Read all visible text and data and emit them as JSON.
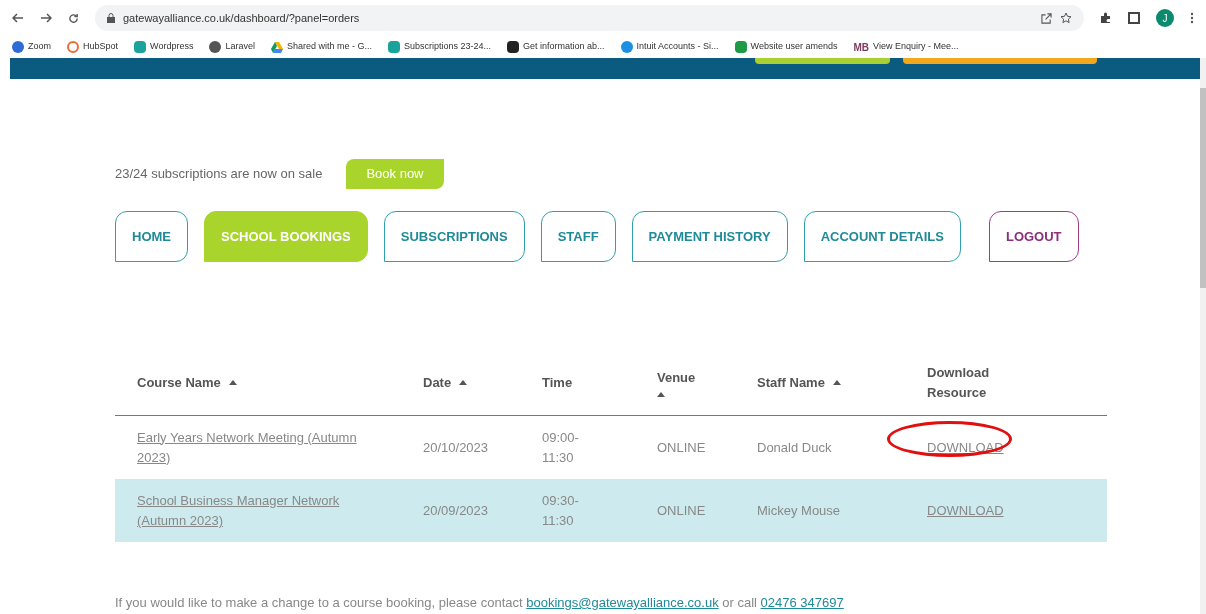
{
  "browser": {
    "url": "gatewayalliance.co.uk/dashboard/?panel=orders",
    "profile_initial": "J",
    "bookmarks": [
      {
        "label": "Zoom",
        "kind": "zoom"
      },
      {
        "label": "HubSpot",
        "kind": "hubspot"
      },
      {
        "label": "Wordpress",
        "kind": "tile"
      },
      {
        "label": "Laravel",
        "kind": "globe"
      },
      {
        "label": "Shared with me - G...",
        "kind": "drive"
      },
      {
        "label": "Subscriptions 23-24...",
        "kind": "tile"
      },
      {
        "label": "Get information ab...",
        "kind": "dark"
      },
      {
        "label": "Intuit Accounts - Si...",
        "kind": "circle"
      },
      {
        "label": "Website user amends",
        "kind": "sheet"
      },
      {
        "label": "View Enquiry - Mee...",
        "kind": "text",
        "icon_text": "MB"
      }
    ]
  },
  "promo": {
    "text": "23/24 subscriptions are now on sale",
    "button": "Book now"
  },
  "tabs": [
    {
      "label": "HOME",
      "selected": false,
      "kind": "nav"
    },
    {
      "label": "SCHOOL BOOKINGS",
      "selected": true,
      "kind": "nav"
    },
    {
      "label": "SUBSCRIPTIONS",
      "selected": false,
      "kind": "nav"
    },
    {
      "label": "STAFF",
      "selected": false,
      "kind": "nav"
    },
    {
      "label": "PAYMENT HISTORY",
      "selected": false,
      "kind": "nav"
    },
    {
      "label": "ACCOUNT DETAILS",
      "selected": false,
      "kind": "nav"
    },
    {
      "label": "LOGOUT",
      "selected": false,
      "kind": "logout"
    }
  ],
  "table": {
    "columns": [
      {
        "label": "Course Name",
        "sortable": true
      },
      {
        "label": "Date",
        "sortable": true
      },
      {
        "label": "Time",
        "sortable": false
      },
      {
        "label": "Venue",
        "sortable": true
      },
      {
        "label": "Staff Name",
        "sortable": true
      },
      {
        "label": "Download Resource",
        "sortable": false
      }
    ],
    "rows": [
      {
        "course": "Early Years Network Meeting (Autumn 2023)",
        "date": "20/10/2023",
        "time": "09:00-11:30",
        "venue": "ONLINE",
        "staff": "Donald Duck",
        "download": "DOWNLOAD",
        "highlighted": false,
        "circled": true
      },
      {
        "course": "School Business Manager Network (Autumn 2023)",
        "date": "20/09/2023",
        "time": "09:30-11:30",
        "venue": "ONLINE",
        "staff": "Mickey Mouse",
        "download": "DOWNLOAD",
        "highlighted": true,
        "circled": false
      }
    ]
  },
  "footer": {
    "text": "If you would like to make a change to a course booking, please contact",
    "email": "bookings@gatewayalliance.co.uk",
    "middle": "or call",
    "phone": "02476 347697"
  }
}
